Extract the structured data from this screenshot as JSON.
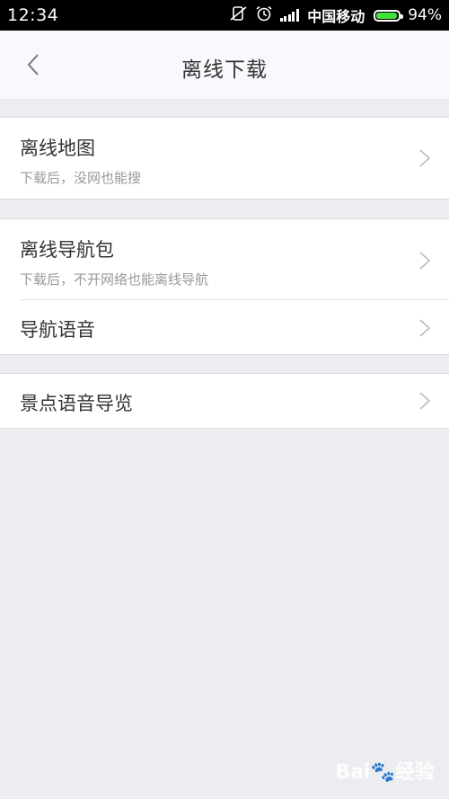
{
  "status_bar": {
    "time": "12:34",
    "carrier": "中国移动",
    "battery_percent": "94%",
    "battery_level": 0.94,
    "icons": [
      "mute-icon",
      "alarm-icon",
      "signal-icon",
      "battery-icon"
    ],
    "battery_color": "#3fe13a"
  },
  "header": {
    "title": "离线下载",
    "back_icon": "chevron-left-icon"
  },
  "sections": [
    {
      "items": [
        {
          "title": "离线地图",
          "subtitle": "下载后，没网也能搜"
        }
      ]
    },
    {
      "items": [
        {
          "title": "离线导航包",
          "subtitle": "下载后，不开网络也能离线导航"
        },
        {
          "title": "导航语音"
        }
      ]
    },
    {
      "items": [
        {
          "title": "景点语音导览"
        }
      ]
    }
  ],
  "watermark": {
    "brand": "Bai",
    "suffix": "经验"
  }
}
